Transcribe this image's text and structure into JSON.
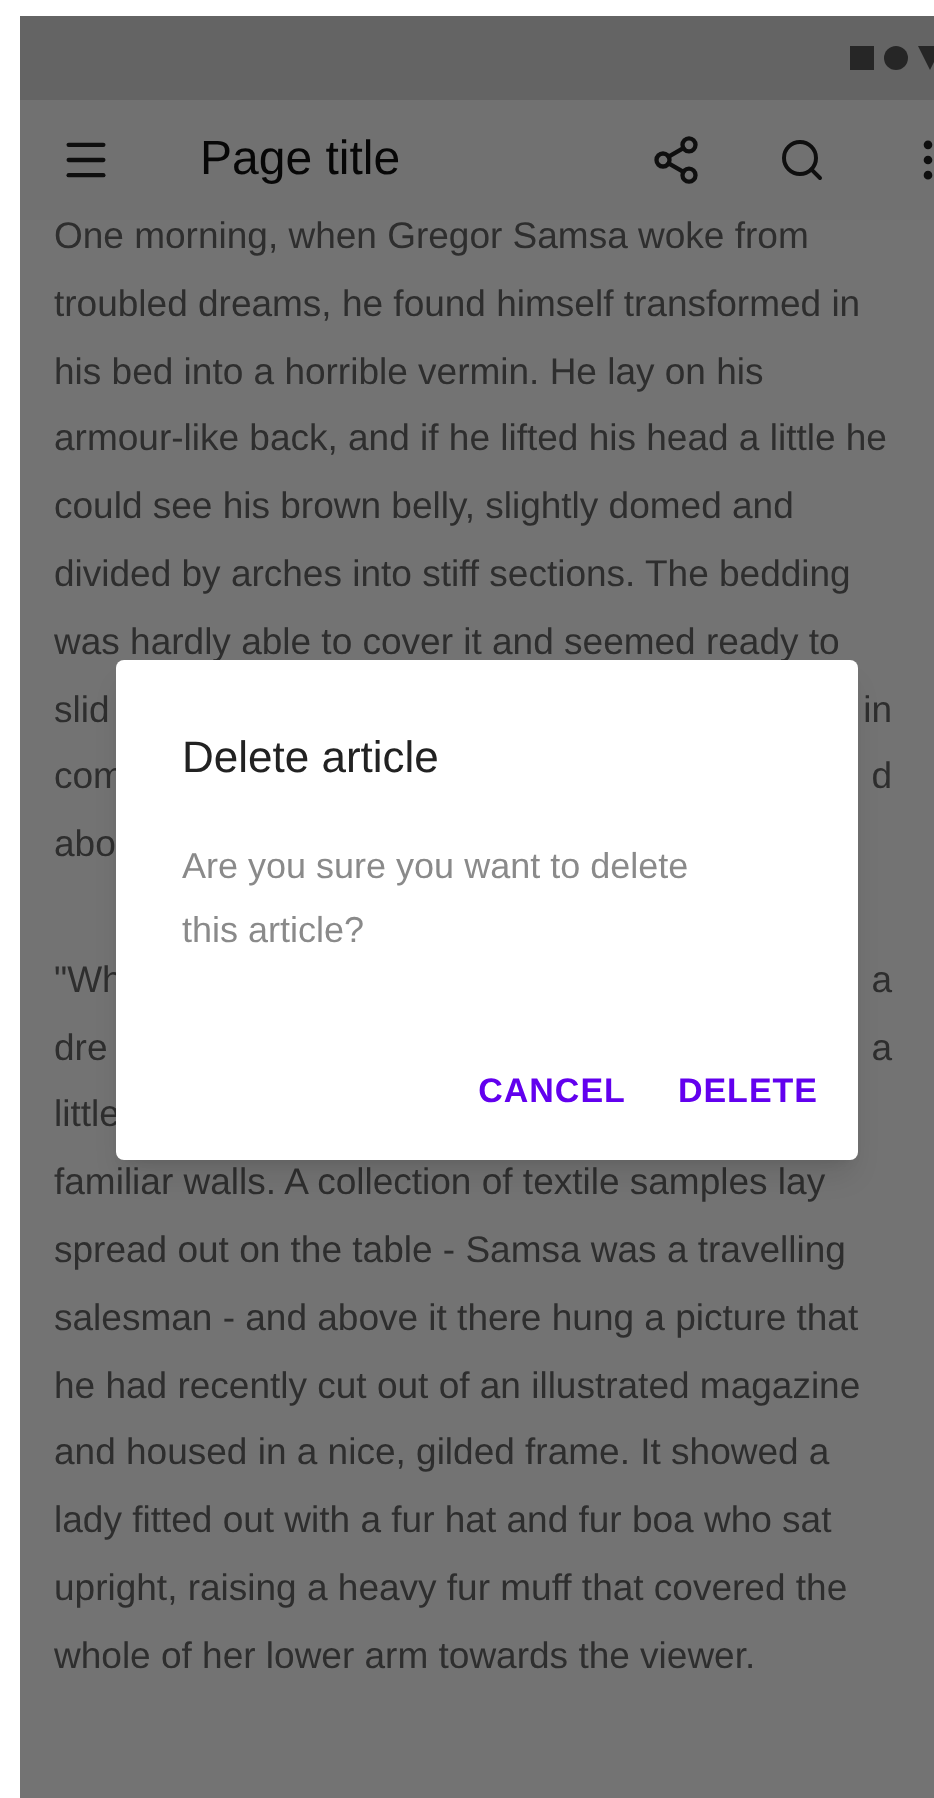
{
  "app_bar": {
    "title": "Page title"
  },
  "article": {
    "paragraphs": [
      {
        "lines": [
          {
            "left": "One morning, when Gregor Samsa woke from"
          },
          {
            "left": "troubled dreams, he found himself transformed in"
          },
          {
            "left": "his bed into a horrible vermin. He lay on his"
          },
          {
            "left": "armour-like back, and if he lifted his head a little he"
          },
          {
            "left": "could see his brown belly, slightly domed and"
          },
          {
            "left": "divided by arches into stiff sections. The bedding"
          },
          {
            "left": "was hardly able to cover it and seemed ready to"
          },
          {
            "left": "slid",
            "right": "in"
          },
          {
            "left": "com",
            "right": "d"
          },
          {
            "left": "abo"
          }
        ]
      },
      {
        "lines": [
          {
            "left": "\"Wh",
            "right": "a"
          },
          {
            "left": "dre",
            "right": "a"
          },
          {
            "left": "little"
          },
          {
            "left": "familiar walls. A collection of textile samples lay"
          },
          {
            "left": "spread out on the table - Samsa was a travelling"
          },
          {
            "left": "salesman - and above it there hung a picture that"
          },
          {
            "left": "he had recently cut out of an illustrated magazine"
          },
          {
            "left": "and housed in a nice, gilded frame. It showed a"
          },
          {
            "left": "lady fitted out with a fur hat and fur boa who sat"
          },
          {
            "left": "upright, raising a heavy fur muff that covered the"
          },
          {
            "left": "whole of her lower arm towards the viewer."
          }
        ]
      }
    ]
  },
  "dialog": {
    "title": "Delete article",
    "message": "Are you sure you want to delete this article?",
    "buttons": [
      "CANCEL",
      "DELETE"
    ]
  }
}
